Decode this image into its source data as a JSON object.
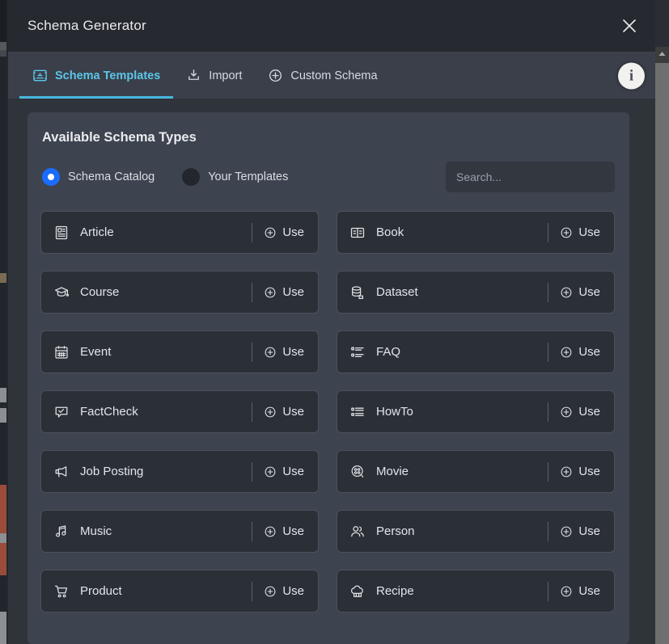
{
  "window": {
    "title": "Schema Generator",
    "close_icon": "close-icon"
  },
  "tabs": [
    {
      "label": "Schema Templates",
      "icon": "schema-template-icon",
      "active": true
    },
    {
      "label": "Import",
      "icon": "import-download-icon",
      "active": false
    },
    {
      "label": "Custom Schema",
      "icon": "plus-circle-icon",
      "active": false
    }
  ],
  "info_badge": {
    "glyph": "i",
    "icon": "info-icon"
  },
  "panel": {
    "title": "Available Schema Types",
    "radios": [
      {
        "label": "Schema Catalog",
        "selected": true
      },
      {
        "label": "Your Templates",
        "selected": false
      }
    ],
    "search": {
      "value": "",
      "placeholder": "Search..."
    },
    "use_label": "Use"
  },
  "schema_types": [
    {
      "label": "Article",
      "icon": "article-icon"
    },
    {
      "label": "Book",
      "icon": "book-icon"
    },
    {
      "label": "Course",
      "icon": "graduation-cap-icon"
    },
    {
      "label": "Dataset",
      "icon": "database-icon"
    },
    {
      "label": "Event",
      "icon": "calendar-icon"
    },
    {
      "label": "FAQ",
      "icon": "list-bullet-icon"
    },
    {
      "label": "FactCheck",
      "icon": "check-speech-bubble-icon"
    },
    {
      "label": "HowTo",
      "icon": "list-steps-icon"
    },
    {
      "label": "Job Posting",
      "icon": "megaphone-icon"
    },
    {
      "label": "Movie",
      "icon": "film-reel-icon"
    },
    {
      "label": "Music",
      "icon": "music-note-icon"
    },
    {
      "label": "Person",
      "icon": "people-icon"
    },
    {
      "label": "Product",
      "icon": "shopping-cart-icon"
    },
    {
      "label": "Recipe",
      "icon": "chef-hat-icon"
    }
  ],
  "colors": {
    "accent_blue": "#48b8e0",
    "radio_selected": "#1a6cff",
    "modal_bg": "#2f333a",
    "panel_bg": "#3e4350",
    "card_bg": "#2b2f36"
  },
  "scrollbar": {
    "up_arrow_icon": "chevron-up-icon"
  }
}
